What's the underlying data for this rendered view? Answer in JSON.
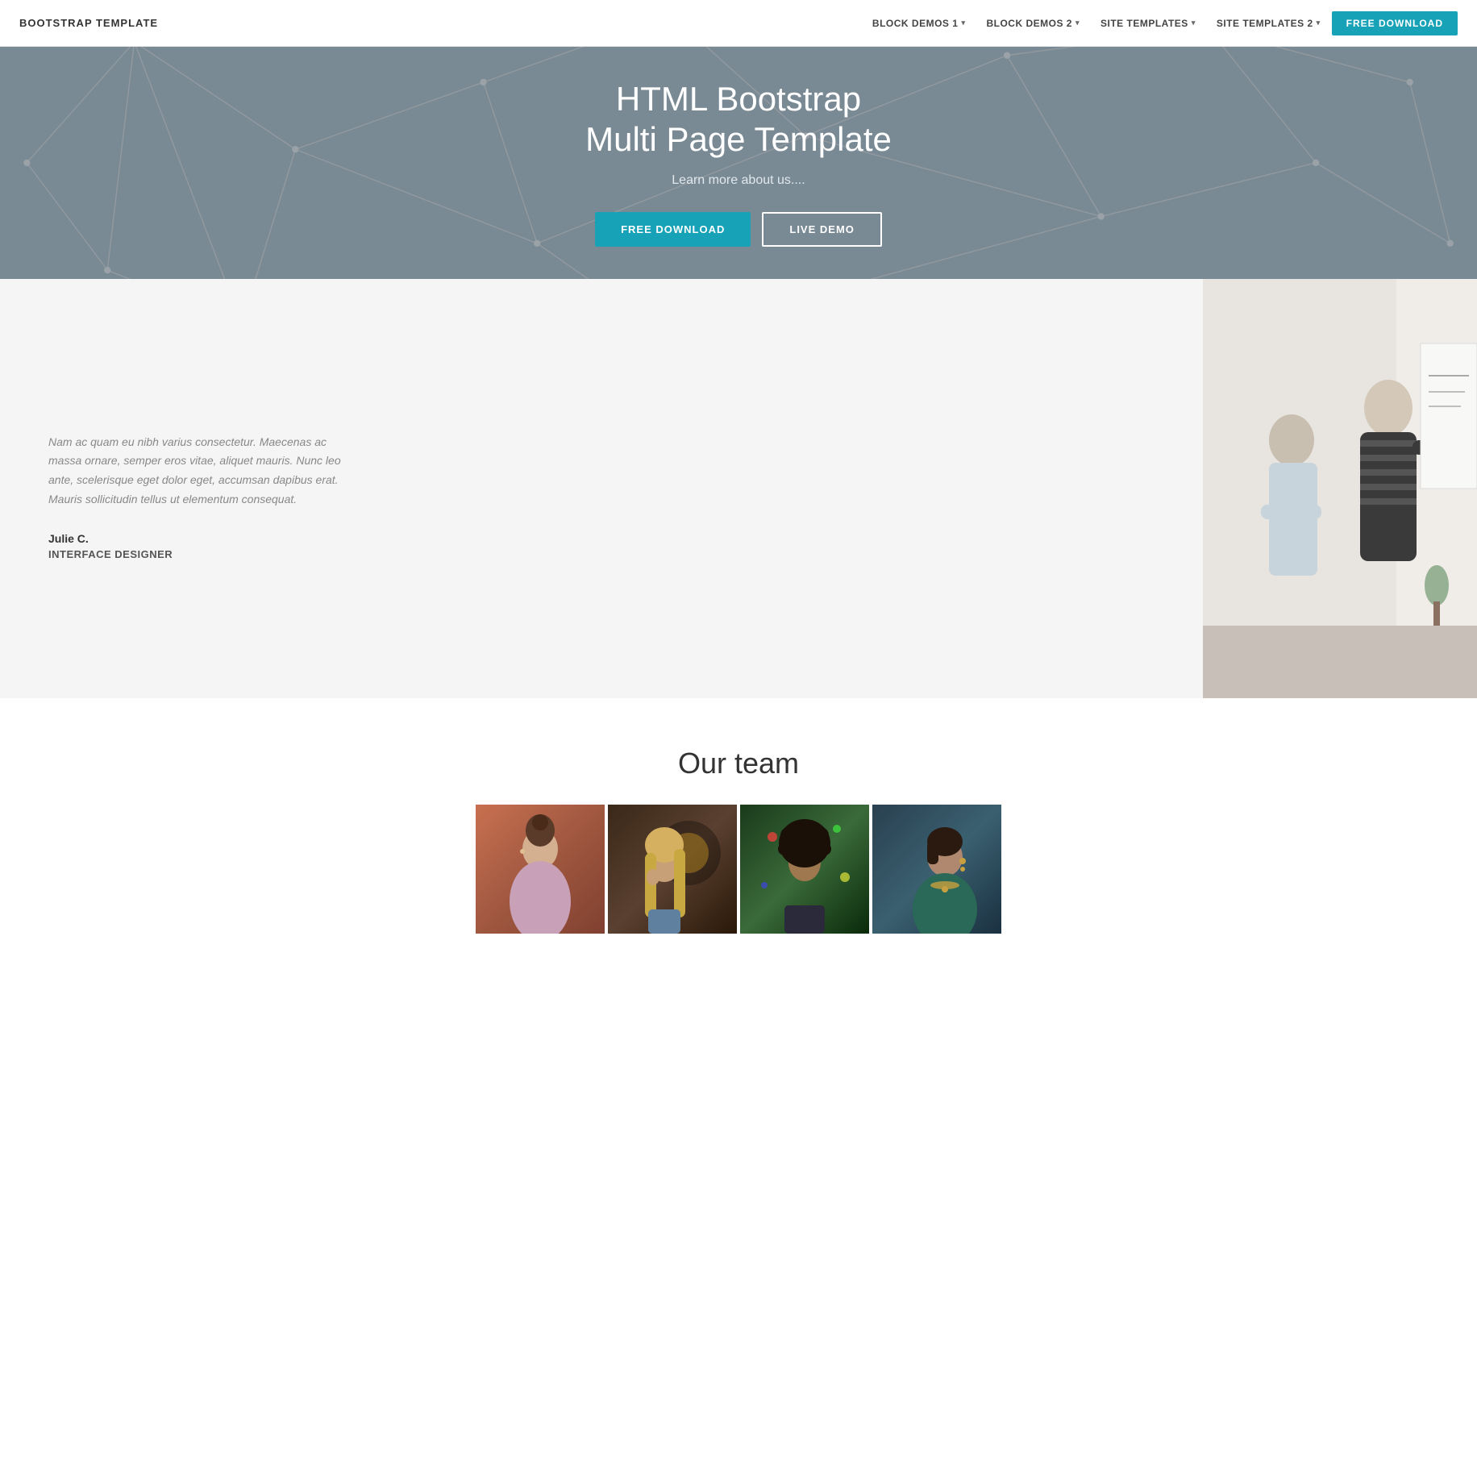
{
  "navbar": {
    "brand": "BOOTSTRAP TEMPLATE",
    "links": [
      {
        "label": "BLOCK DEMOS 1",
        "has_dropdown": true
      },
      {
        "label": "BLOCK DEMOS 2",
        "has_dropdown": true
      },
      {
        "label": "SITE TEMPLATES",
        "has_dropdown": true
      },
      {
        "label": "SITE TEMPLATES 2",
        "has_dropdown": true
      }
    ],
    "cta_label": "FREE DOWNLOAD"
  },
  "hero": {
    "title_line1": "HTML Bootstrap",
    "title_line2": "Multi Page Template",
    "subtitle": "Learn more about us....",
    "btn_primary": "FREE DOWNLOAD",
    "btn_secondary": "LIVE DEMO"
  },
  "about": {
    "quote": "Nam ac quam eu nibh varius consectetur. Maecenas ac massa ornare, semper eros vitae, aliquet mauris. Nunc leo ante, scelerisque eget dolor eget, accumsan dapibus erat. Mauris sollicitudin tellus ut elementum consequat.",
    "name": "Julie C.",
    "role": "INTERFACE DESIGNER"
  },
  "team": {
    "title": "Our team",
    "members": [
      {
        "id": 1,
        "photo_class": "photo-1"
      },
      {
        "id": 2,
        "photo_class": "photo-2"
      },
      {
        "id": 3,
        "photo_class": "photo-3"
      },
      {
        "id": 4,
        "photo_class": "photo-4"
      }
    ]
  }
}
